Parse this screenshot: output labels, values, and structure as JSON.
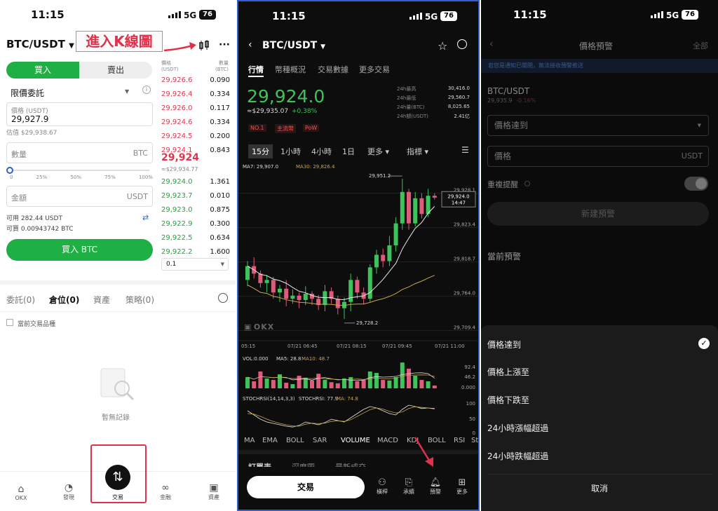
{
  "status": {
    "time": "11:15",
    "network": "5G",
    "battery": "76"
  },
  "panel1": {
    "pair": "BTC/USDT",
    "annotation": "進入K線圖",
    "buy_tab": "買入",
    "sell_tab": "賣出",
    "order_type": "限價委託",
    "price_label": "價格 (USDT)",
    "price_value": "29,927.9",
    "price_estimate": "估值 $29,938.67",
    "qty_label": "數量",
    "qty_unit": "BTC",
    "slider_marks": [
      "0",
      "25%",
      "50%",
      "75%",
      "100%"
    ],
    "amount_label": "金額",
    "amount_unit": "USDT",
    "available_label": "可用 282.44 USDT",
    "buyable_label": "可買 0.00943742 BTC",
    "buy_button": "買入 BTC",
    "ob_price_header": "價格\n(USDT)",
    "ob_qty_header": "數量\n(BTC)",
    "asks": [
      {
        "price": "29,926.6",
        "qty": "0.090"
      },
      {
        "price": "29,926.4",
        "qty": "0.334"
      },
      {
        "price": "29,926.0",
        "qty": "0.117"
      },
      {
        "price": "29,924.6",
        "qty": "0.334"
      },
      {
        "price": "29,924.5",
        "qty": "0.200"
      },
      {
        "price": "29,924.1",
        "qty": "0.843"
      }
    ],
    "last_price": "29,924",
    "last_price_fiat": "≈$29,934.77",
    "bids": [
      {
        "price": "29,924.0",
        "qty": "1.361"
      },
      {
        "price": "29,923.7",
        "qty": "0.010"
      },
      {
        "price": "29,923.0",
        "qty": "0.875"
      },
      {
        "price": "29,922.9",
        "qty": "0.300"
      },
      {
        "price": "29,922.5",
        "qty": "0.634"
      },
      {
        "price": "29,922.2",
        "qty": "1.600"
      }
    ],
    "depth_select": "0.1",
    "bottom_tabs": [
      "委託(0)",
      "倉位(0)",
      "資產",
      "策略(0)"
    ],
    "filter_label": "當前交易品種",
    "empty_label": "暫無記錄",
    "nav": [
      "OKX",
      "發現",
      "交易",
      "金融",
      "資產"
    ]
  },
  "panel2": {
    "pair": "BTC/USDT",
    "tabs": [
      "行情",
      "幣種概況",
      "交易數據",
      "更多交易"
    ],
    "price": "29,924.0",
    "price_fiat": "≈$29,935.07",
    "change": "+0.38%",
    "tags": [
      "NO.1",
      "主流幣",
      "PoW"
    ],
    "stats": [
      {
        "label": "24h最高",
        "value": "30,416.0"
      },
      {
        "label": "24h最低",
        "value": "29,560.7"
      },
      {
        "label": "24h量(BTC)",
        "value": "8,025.65"
      },
      {
        "label": "24h額(USDT)",
        "value": "2.41亿"
      }
    ],
    "timeframes": [
      "15分",
      "1小時",
      "4小時",
      "1日",
      "更多 ▾",
      "指標 ▾"
    ],
    "ma_legend": {
      "ma7": "MA7: 29,907.0",
      "ma30": "MA30: 29,826.4"
    },
    "price_axis": [
      "29,928.1",
      "29,823.4",
      "29,818.7",
      "29,764.0",
      "29,709.4"
    ],
    "current_price_box": "29,924.0",
    "countdown": "14:47",
    "high_label": "29,951.2",
    "low_label": "29,728.2",
    "time_axis": [
      "05:15",
      "07/21 06:45",
      "07/21 08:15",
      "07/21 09:45",
      "07/21 11:00"
    ],
    "vol_legend": {
      "vol": "VOL:0.000",
      "ma5": "MA5: 28.8",
      "ma10": "MA10: 48.7"
    },
    "vol_axis": [
      "92.4",
      "46.2",
      "0.000"
    ],
    "stoch_legend": {
      "label": "STOCHRSI(14,14,3,3)",
      "stoch": "STOCHRSI: 77.9",
      "ma": "MA: 74.8"
    },
    "stoch_axis": [
      "100",
      "50",
      "0"
    ],
    "indicator_tabs": [
      "MA",
      "EMA",
      "BOLL",
      "SAR",
      "VOLUME",
      "MACD",
      "KDJ",
      "BOLL",
      "RSI",
      "St"
    ],
    "lower_tabs": [
      "訂單表",
      "深度圖",
      "最新成交"
    ],
    "trade_button": "交易",
    "bottom_icons": [
      "橫桿",
      "承續",
      "預警",
      "更多"
    ],
    "logo": "OKX",
    "candles": [
      {
        "o": 29790,
        "c": 29812,
        "h": 29820,
        "l": 29780
      },
      {
        "o": 29812,
        "c": 29800,
        "h": 29826,
        "l": 29792
      },
      {
        "o": 29800,
        "c": 29785,
        "h": 29805,
        "l": 29778
      },
      {
        "o": 29785,
        "c": 29790,
        "h": 29798,
        "l": 29770
      },
      {
        "o": 29790,
        "c": 29770,
        "h": 29795,
        "l": 29760
      },
      {
        "o": 29770,
        "c": 29776,
        "h": 29782,
        "l": 29755
      },
      {
        "o": 29776,
        "c": 29760,
        "h": 29790,
        "l": 29748
      },
      {
        "o": 29760,
        "c": 29765,
        "h": 29775,
        "l": 29752
      },
      {
        "o": 29765,
        "c": 29758,
        "h": 29770,
        "l": 29745
      },
      {
        "o": 29758,
        "c": 29768,
        "h": 29780,
        "l": 29750
      },
      {
        "o": 29768,
        "c": 29760,
        "h": 29772,
        "l": 29750
      },
      {
        "o": 29760,
        "c": 29750,
        "h": 29766,
        "l": 29742
      },
      {
        "o": 29750,
        "c": 29772,
        "h": 29782,
        "l": 29740
      },
      {
        "o": 29772,
        "c": 29760,
        "h": 29778,
        "l": 29752
      },
      {
        "o": 29760,
        "c": 29745,
        "h": 29765,
        "l": 29735
      },
      {
        "o": 29745,
        "c": 29755,
        "h": 29762,
        "l": 29728
      },
      {
        "o": 29755,
        "c": 29790,
        "h": 29800,
        "l": 29740
      },
      {
        "o": 29790,
        "c": 29770,
        "h": 29795,
        "l": 29760
      },
      {
        "o": 29770,
        "c": 29760,
        "h": 29778,
        "l": 29752
      },
      {
        "o": 29760,
        "c": 29810,
        "h": 29815,
        "l": 29755
      },
      {
        "o": 29810,
        "c": 29830,
        "h": 29838,
        "l": 29800
      },
      {
        "o": 29830,
        "c": 29820,
        "h": 29840,
        "l": 29810
      },
      {
        "o": 29820,
        "c": 29845,
        "h": 29860,
        "l": 29812
      },
      {
        "o": 29845,
        "c": 29880,
        "h": 29890,
        "l": 29835
      },
      {
        "o": 29880,
        "c": 29930,
        "h": 29951,
        "l": 29870
      },
      {
        "o": 29930,
        "c": 29880,
        "h": 29935,
        "l": 29870
      },
      {
        "o": 29880,
        "c": 29920,
        "h": 29930,
        "l": 29875
      },
      {
        "o": 29920,
        "c": 29895,
        "h": 29928,
        "l": 29888
      },
      {
        "o": 29895,
        "c": 29924,
        "h": 29935,
        "l": 29890
      },
      {
        "o": 29924,
        "c": 29921,
        "h": 29928,
        "l": 29918
      }
    ],
    "volumes": [
      40,
      25,
      60,
      35,
      30,
      50,
      20,
      15,
      45,
      38,
      28,
      52,
      30,
      22,
      18,
      35,
      40,
      25,
      30,
      60,
      55,
      30,
      28,
      40,
      92,
      70,
      45,
      30,
      25,
      10
    ]
  },
  "panel3": {
    "title": "價格預警",
    "right_action": "全部",
    "banner": "若您是通知已關閉，無法接收預警推送",
    "pair": "BTC/USDT",
    "pair_price": "29,935.9",
    "pair_change": "-0.16%",
    "condition_placeholder": "價格達到",
    "price_placeholder": "價格",
    "price_unit": "USDT",
    "repeat_label": "重複提醒",
    "create_button": "新建預警",
    "current_label": "當前預警",
    "options": [
      "價格達到",
      "價格上漲至",
      "價格下跌至",
      "24小時漲幅超過",
      "24小時跌幅超過"
    ],
    "cancel": "取消"
  },
  "colors": {
    "up": "#1ea43a",
    "down": "#e0334c",
    "accent_blue": "#2f5fd0",
    "annotation_red": "#e0304a"
  }
}
